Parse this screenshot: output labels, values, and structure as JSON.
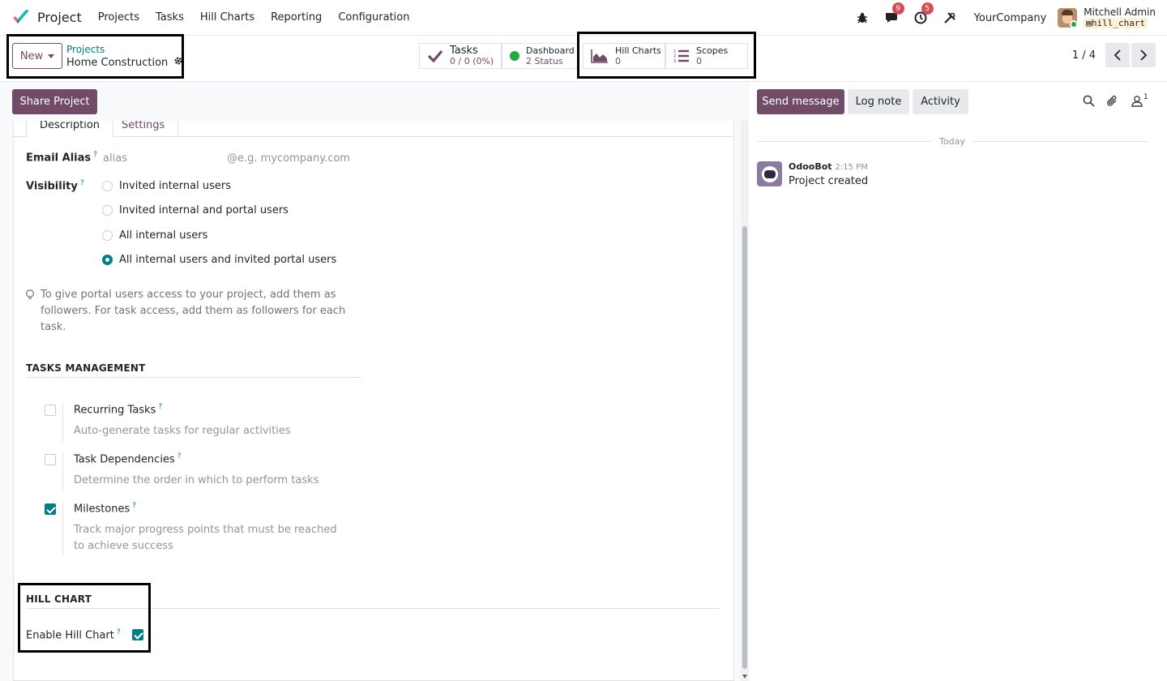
{
  "navbar": {
    "app_name": "Project",
    "menu": [
      "Projects",
      "Tasks",
      "Hill Charts",
      "Reporting",
      "Configuration"
    ],
    "messages_badge": "9",
    "activities_badge": "5",
    "company": "YourCompany",
    "user_name": "Mitchell Admin",
    "db_name": "hill_chart"
  },
  "control": {
    "new_label": "New",
    "breadcrumb_parent": "Projects",
    "breadcrumb_current": "Home Construction",
    "stats": {
      "tasks": {
        "title": "Tasks",
        "value": "0 / 0 (0%)"
      },
      "dashboard": {
        "title": "Dashboard",
        "value": "2 Status"
      },
      "hill_charts": {
        "title": "Hill Charts",
        "value": "0"
      },
      "scopes": {
        "title": "Scopes",
        "value": "0"
      }
    },
    "pager": "1 / 4"
  },
  "form": {
    "share_label": "Share Project",
    "tabs": [
      "Description",
      "Settings"
    ],
    "email_alias_label": "Email Alias",
    "alias_placeholder": "alias",
    "domain_placeholder": "@e.g. mycompany.com",
    "visibility_label": "Visibility",
    "visibility_options": [
      "Invited internal users",
      "Invited internal and portal users",
      "All internal users",
      "All internal users and invited portal users"
    ],
    "visibility_selected_index": 3,
    "hint": "To give portal users access to your project, add them as followers. For task access, add them as followers for each task.",
    "tasks_management_title": "TASKS MANAGEMENT",
    "tasks_options": [
      {
        "title": "Recurring Tasks",
        "desc": "Auto-generate tasks for regular activities",
        "checked": false
      },
      {
        "title": "Task Dependencies",
        "desc": "Determine the order in which to perform tasks",
        "checked": false
      },
      {
        "title": "Milestones",
        "desc": "Track major progress points that must be reached to achieve success",
        "checked": true
      }
    ],
    "hill_chart_title": "HILL CHART",
    "enable_hill_chart_label": "Enable Hill Chart",
    "enable_hill_chart_checked": true,
    "help_mark": "?"
  },
  "chatter": {
    "send_message": "Send message",
    "log_note": "Log note",
    "activity": "Activity",
    "followers_count": "1",
    "date_separator": "Today",
    "message": {
      "author": "OdooBot",
      "time": "2:15 PM",
      "text": "Project created"
    }
  },
  "colors": {
    "brand": "#714b67",
    "accent": "#017e84",
    "badge": "#d44c59"
  }
}
